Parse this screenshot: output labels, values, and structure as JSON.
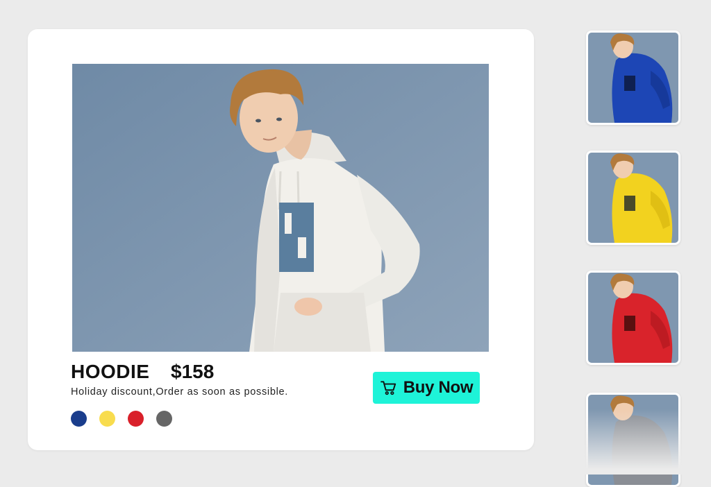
{
  "product": {
    "name": "HOODIE",
    "price": "$158",
    "description": "Holiday discount,Order as soon as possible.",
    "buy_label": "Buy Now"
  },
  "colors": {
    "accent": "#1ef3d8",
    "photo_background": "#7f97b0",
    "swatches": [
      "#1a3d8c",
      "#f8dc4e",
      "#d9202a",
      "#666666"
    ]
  },
  "main_hoodie_color": "#f2f0eb",
  "thumbnails": [
    {
      "color": "blue",
      "hoodie_color": "#1d46b5"
    },
    {
      "color": "yellow",
      "hoodie_color": "#f2d21f"
    },
    {
      "color": "red",
      "hoodie_color": "#d9232b"
    },
    {
      "color": "grey",
      "hoodie_color": "#8a8e95"
    }
  ],
  "icons": {
    "cart": "shopping-cart-icon"
  }
}
